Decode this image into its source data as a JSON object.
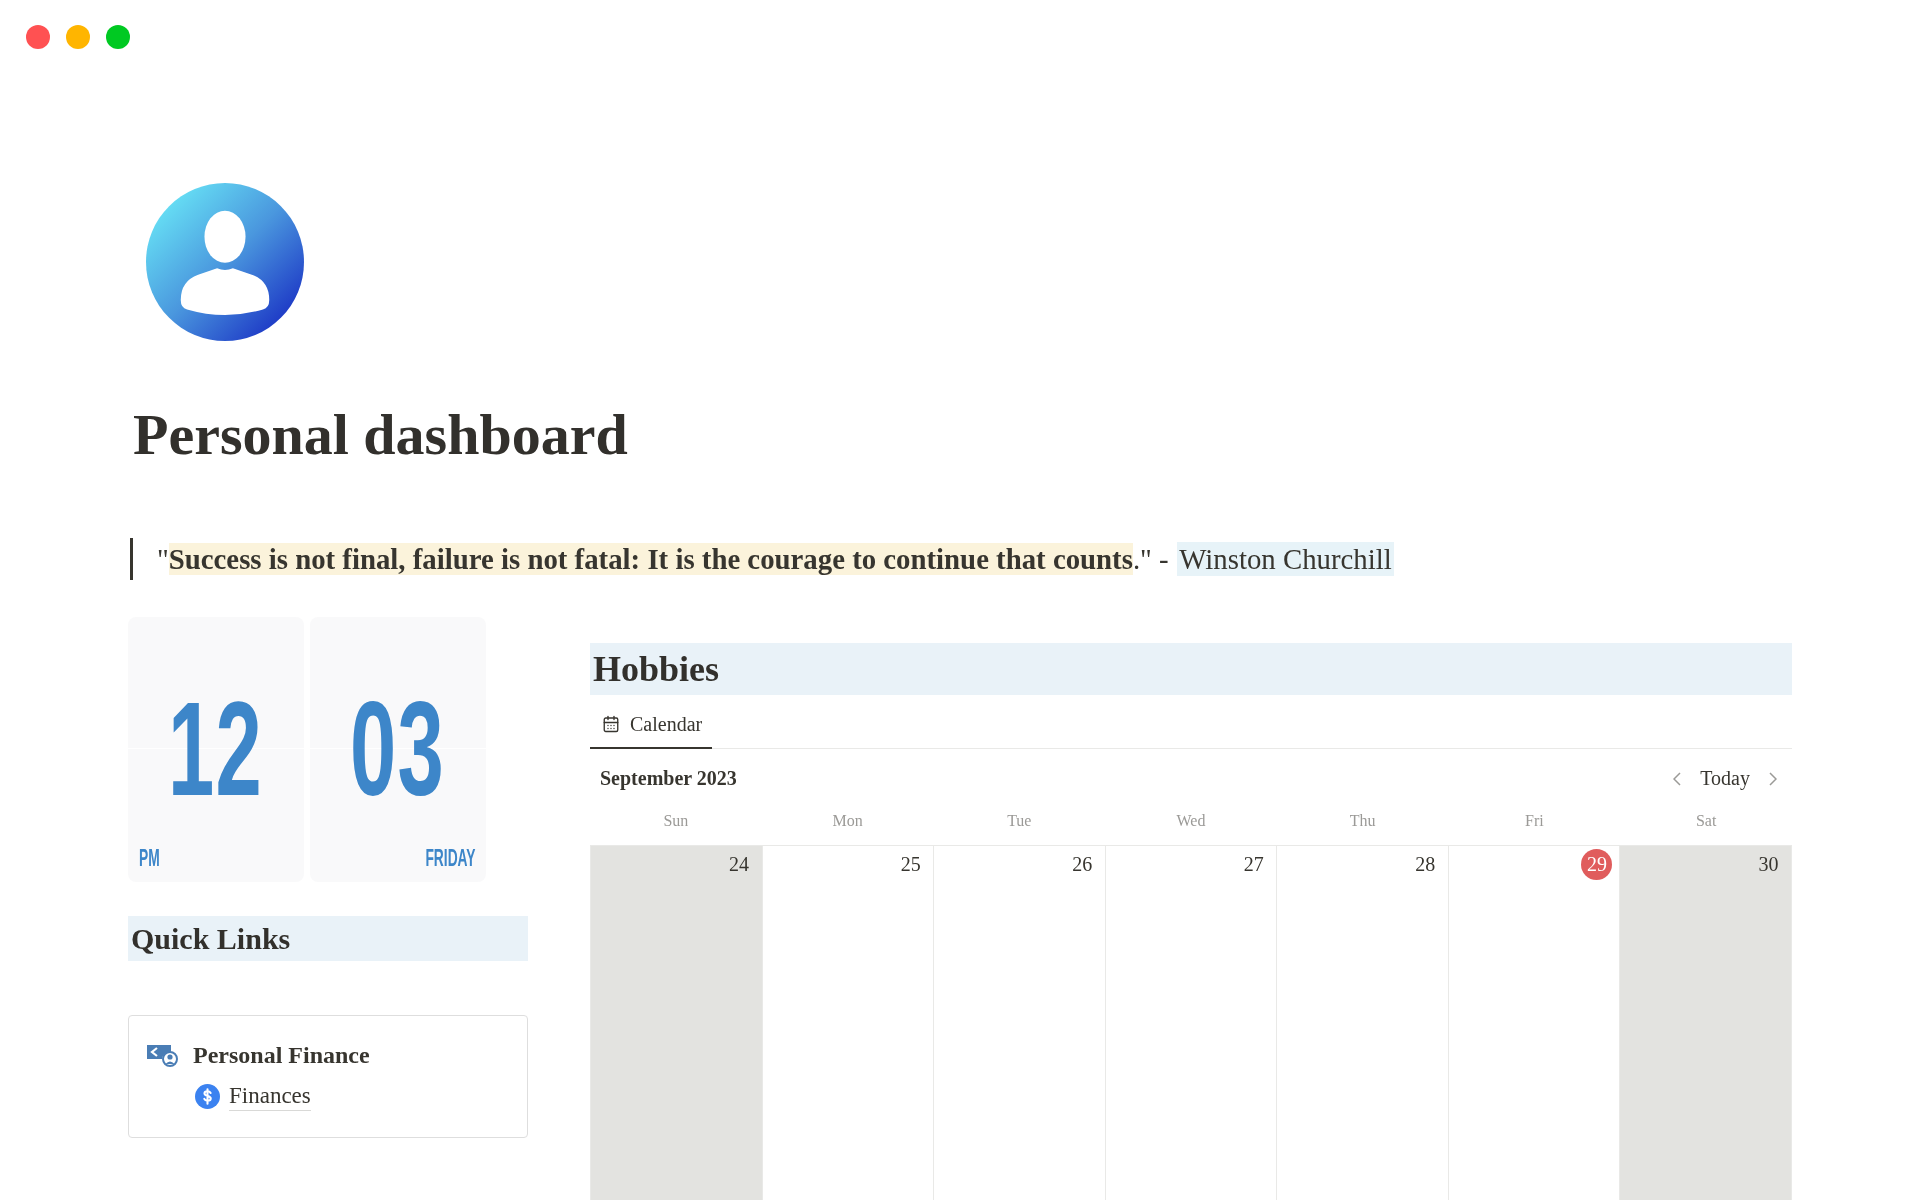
{
  "window": {
    "controls": [
      {
        "color": "#ff5152"
      },
      {
        "color": "#ffb500"
      },
      {
        "color": "#00c922"
      }
    ]
  },
  "page": {
    "title": "Personal dashboard"
  },
  "quote": {
    "text": "\"**Success is not final, failure is not fatal: It is the courage to continue that counts**.\" -",
    "author": "Winston Churchill"
  },
  "clock": {
    "hours": "12",
    "minutes": "03",
    "period": "PM",
    "weekday": "FRIDAY"
  },
  "quick_links": {
    "heading": "Quick Links",
    "card": {
      "title": "Personal Finance",
      "links": [
        {
          "label": "Finances"
        }
      ]
    }
  },
  "hobbies": {
    "heading": "Hobbies",
    "views": [
      {
        "label": "Calendar",
        "selected": true
      }
    ],
    "calendar": {
      "month": "September 2023",
      "today_button": "Today",
      "weekdays": [
        "Sun",
        "Mon",
        "Tue",
        "Wed",
        "Thu",
        "Fri",
        "Sat"
      ],
      "days": [
        {
          "day": "24",
          "weekend": true,
          "today": false
        },
        {
          "day": "25",
          "weekend": false,
          "today": false
        },
        {
          "day": "26",
          "weekend": false,
          "today": false
        },
        {
          "day": "27",
          "weekend": false,
          "today": false
        },
        {
          "day": "28",
          "weekend": false,
          "today": false
        },
        {
          "day": "29",
          "weekend": false,
          "today": true
        },
        {
          "day": "30",
          "weekend": true,
          "today": false
        }
      ]
    }
  }
}
